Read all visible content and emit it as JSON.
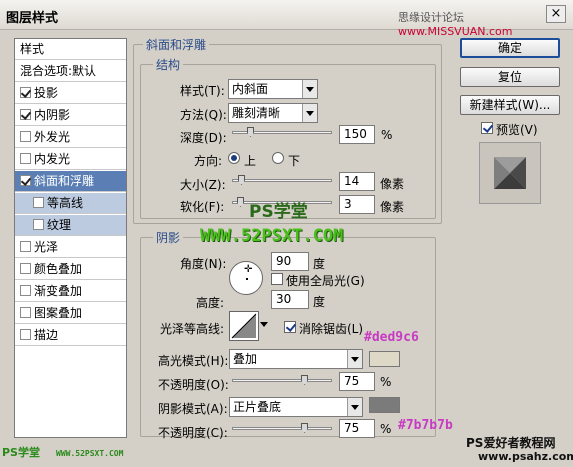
{
  "window": {
    "title": "图层样式",
    "watermark_a": "思缘设计论坛",
    "watermark_b": "www.MISSVUAN.com",
    "close": "×"
  },
  "left_panel": {
    "header": "样式",
    "blend": "混合选项:默认",
    "items": [
      {
        "label": "投影",
        "checked": true
      },
      {
        "label": "内阴影",
        "checked": true
      },
      {
        "label": "外发光",
        "checked": false
      },
      {
        "label": "内发光",
        "checked": false
      },
      {
        "label": "斜面和浮雕",
        "checked": true,
        "selected": true
      },
      {
        "label": "等高线",
        "checked": false,
        "sub": true
      },
      {
        "label": "纹理",
        "checked": false,
        "sub": true
      },
      {
        "label": "光泽",
        "checked": false
      },
      {
        "label": "颜色叠加",
        "checked": false
      },
      {
        "label": "渐变叠加",
        "checked": false
      },
      {
        "label": "图案叠加",
        "checked": false
      },
      {
        "label": "描边",
        "checked": false
      }
    ]
  },
  "bevel": {
    "section": "斜面和浮雕",
    "structure": "结构",
    "style_label": "样式(T):",
    "style_value": "内斜面",
    "technique_label": "方法(Q):",
    "technique_value": "雕刻清晰",
    "depth_label": "深度(D):",
    "depth_value": "150",
    "depth_unit": "%",
    "depth_fraction": 0.15,
    "direction_label": "方向:",
    "direction_up": "上",
    "direction_down": "下",
    "size_label": "大小(Z):",
    "size_value": "14",
    "size_unit": "像素",
    "size_fraction": 0.06,
    "soften_label": "软化(F):",
    "soften_value": "3",
    "soften_unit": "像素",
    "soften_fraction": 0.04
  },
  "shading": {
    "section": "阴影",
    "angle_label": "角度(N):",
    "angle_value": "90",
    "angle_unit": "度",
    "global_light_label": "使用全局光(G)",
    "altitude_label": "高度:",
    "altitude_value": "30",
    "altitude_unit": "度",
    "gloss_label": "光泽等高线:",
    "antialias_label": "消除锯齿(L)",
    "highlight_mode_label": "高光模式(H):",
    "highlight_mode_value": "叠加",
    "highlight_color": "#ded9c6",
    "highlight_opacity_label": "不透明度(O):",
    "highlight_opacity_value": "75",
    "highlight_opacity_unit": "%",
    "highlight_opacity_fraction": 0.75,
    "shadow_mode_label": "阴影模式(A):",
    "shadow_mode_value": "正片叠底",
    "shadow_color": "#7b7b7b",
    "shadow_opacity_label": "不透明度(C):",
    "shadow_opacity_value": "75",
    "shadow_opacity_unit": "%",
    "shadow_opacity_fraction": 0.75
  },
  "buttons": {
    "ok": "确定",
    "reset": "复位",
    "new_style": "新建样式(W)...",
    "preview": "预览(V)"
  },
  "overlays": {
    "ps_school": "PS学堂",
    "site_url": "WWW.52PSXT.COM",
    "hex_highlight": "#ded9c6",
    "hex_shadow": "#7b7b7b",
    "bottom_left": "PS学堂",
    "bottom_left_url": "WWW.52PSXT.COM",
    "bottom_right_a": "PS爱好者教程网",
    "bottom_right_b": "www.psahz.com"
  }
}
